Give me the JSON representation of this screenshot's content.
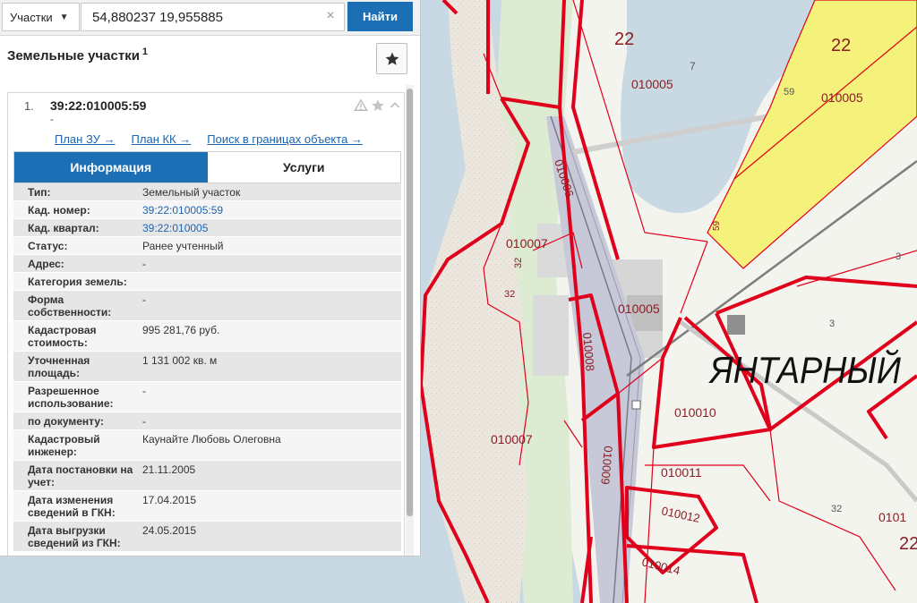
{
  "search": {
    "type_label": "Участки",
    "query": "54,880237 19,955885",
    "clear_symbol": "×",
    "button_label": "Найти"
  },
  "panel": {
    "title": "Земельные участки",
    "count": "1",
    "favorites_icon": "star-icon"
  },
  "result": {
    "index": "1.",
    "cadastral_number": "39:22:010005:59",
    "subtitle": "-",
    "icons": [
      "warning-icon",
      "star-icon",
      "chevron-up-icon"
    ],
    "links": [
      "План ЗУ →",
      "План КК →",
      "Поиск в границах объекта →"
    ],
    "tabs": [
      "Информация",
      "Услуги"
    ],
    "active_tab": "Информация",
    "fields": [
      {
        "label": "Тип:",
        "value": "Земельный участок"
      },
      {
        "label": "Кад. номер:",
        "value": "39:22:010005:59"
      },
      {
        "label": "Кад. квартал:",
        "value": "39:22:010005"
      },
      {
        "label": "Статус:",
        "value": "Ранее учтенный"
      },
      {
        "label": "Адрес:",
        "value": "-"
      },
      {
        "label": "Категория земель:",
        "value": ""
      },
      {
        "label": "Форма собственности:",
        "value": "-"
      },
      {
        "label": "Кадастровая стоимость:",
        "value": "995 281,76 руб."
      },
      {
        "label": "Уточненная площадь:",
        "value": "1 131 002 кв. м"
      },
      {
        "label": "Разрешенное использование:",
        "value": "-"
      },
      {
        "label": "по документу:",
        "value": "-"
      },
      {
        "label": "Кадастровый инженер:",
        "value": "Каунайте Любовь Олеговна"
      },
      {
        "label": "Дата постановки на учет:",
        "value": "21.11.2005"
      },
      {
        "label": "Дата изменения сведений в ГКН:",
        "value": "17.04.2015"
      },
      {
        "label": "Дата выгрузки сведений из ГКН:",
        "value": "24.05.2015"
      }
    ]
  },
  "map": {
    "place_name": "ЯНТАРНЫЙ",
    "labels": [
      "22",
      "7",
      "010005",
      "22",
      "59",
      "010005",
      "010006",
      "010007",
      "32",
      "32",
      "010005",
      "59",
      "3",
      "3",
      "010008",
      "010010",
      "010007",
      "010009",
      "010011",
      "010012",
      "32",
      "010014",
      "0101",
      "22"
    ]
  },
  "colors": {
    "accent": "#1c6fb4",
    "link": "#1d64b0",
    "parcel_border": "#e0001b",
    "selected_parcel": "#f4f27a",
    "water": "#c9d9e3",
    "land": "#f4f4ef",
    "beach": "#ece7de"
  }
}
